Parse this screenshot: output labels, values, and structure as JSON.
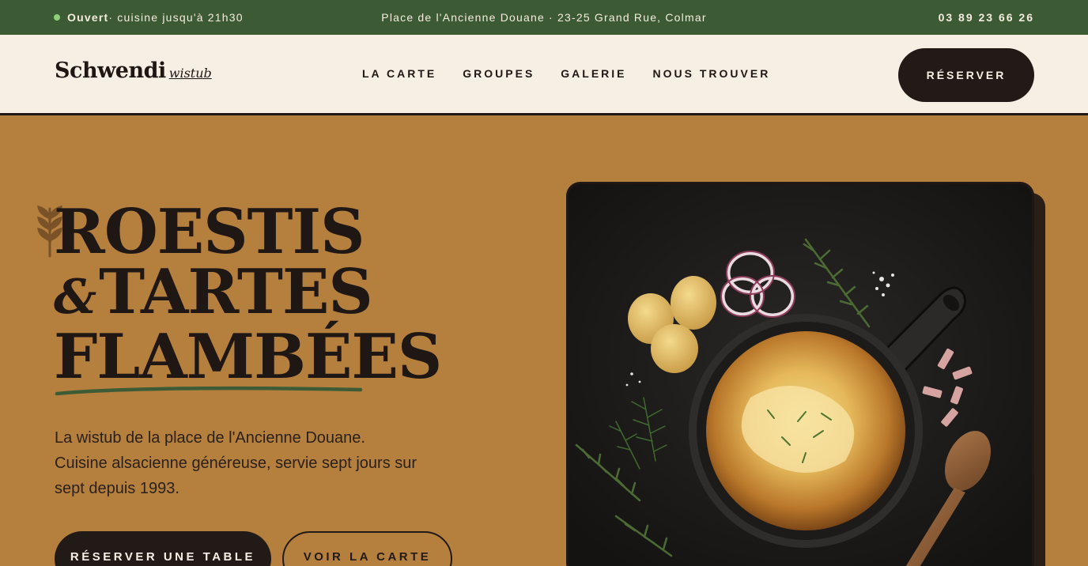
{
  "topbar": {
    "status_bold": "Ouvert",
    "status_rest": " · cuisine jusqu'à 21h30",
    "address": "Place de l'Ancienne Douane · 23-25 Grand Rue, Colmar",
    "phone": "03 89 23 66 26"
  },
  "header": {
    "logo_name": "Schwendi",
    "logo_sub": "wistub",
    "nav": [
      "LA CARTE",
      "GROUPES",
      "GALERIE",
      "NOUS TROUVER"
    ],
    "reserve_label": "RÉSERVER"
  },
  "hero": {
    "title_line1": "ROESTIS",
    "title_amp": "&",
    "title_line2": "TARTES",
    "title_line3": "FLAMBÉES",
    "description": "La wistub de la place de l'Ancienne Douane. Cuisine alsacienne généreuse, servie sept jours sur sept depuis 1993.",
    "primary_cta": "RÉSERVER UNE TABLE",
    "secondary_cta": "VOIR LA CARTE"
  },
  "colors": {
    "topbar": "#3c5a33",
    "hero_bg": "#b57f3e",
    "nav_bg": "#f5efe4",
    "dark": "#221a16",
    "accent_green": "#3d5c36"
  },
  "icons": {
    "status": "status-dot-icon",
    "wheat": "wheat-icon"
  }
}
